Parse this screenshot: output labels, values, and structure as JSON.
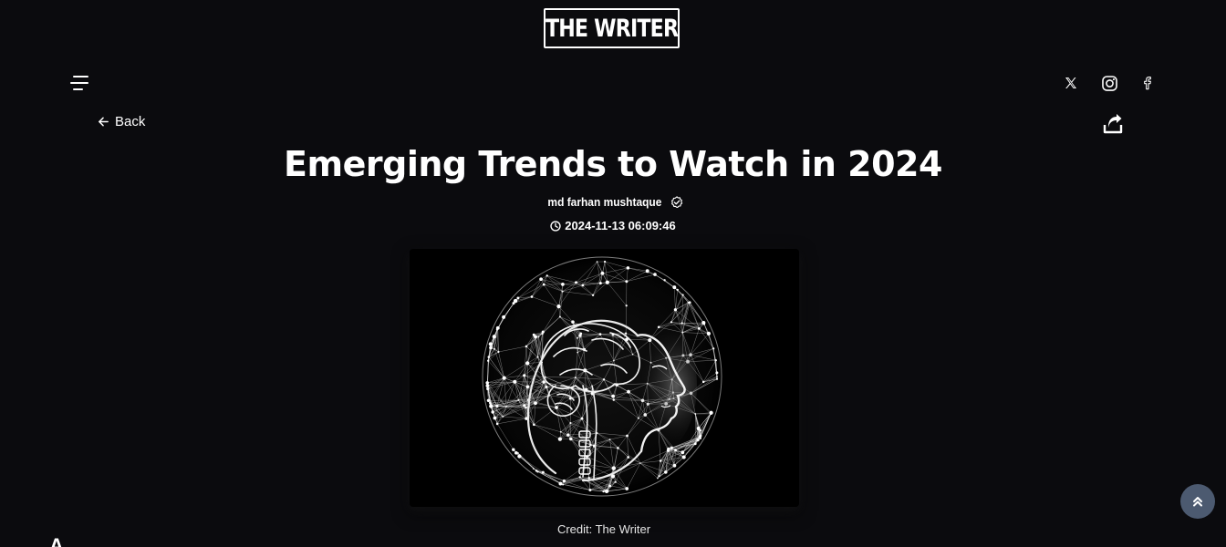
{
  "header": {
    "logo_text": "THE WRITER"
  },
  "nav": {
    "back_label": "Back"
  },
  "icons": {
    "menu": "menu-icon",
    "twitter": "x-icon",
    "instagram": "instagram-icon",
    "facebook": "facebook-icon",
    "share": "share-icon",
    "verified": "verified-badge-icon",
    "clock": "clock-icon",
    "scroll_top": "double-chevron-up-icon"
  },
  "article": {
    "title": "Emerging Trends to Watch in 2024",
    "author": "md farhan mushtaque",
    "published": "2024-11-13 06:09:46",
    "image_credit": "Credit: The Writer",
    "body_first_letter": "A"
  },
  "colors": {
    "background": "#0b0b0e",
    "text": "#ffffff",
    "scroll_button": "#4c5a70"
  }
}
